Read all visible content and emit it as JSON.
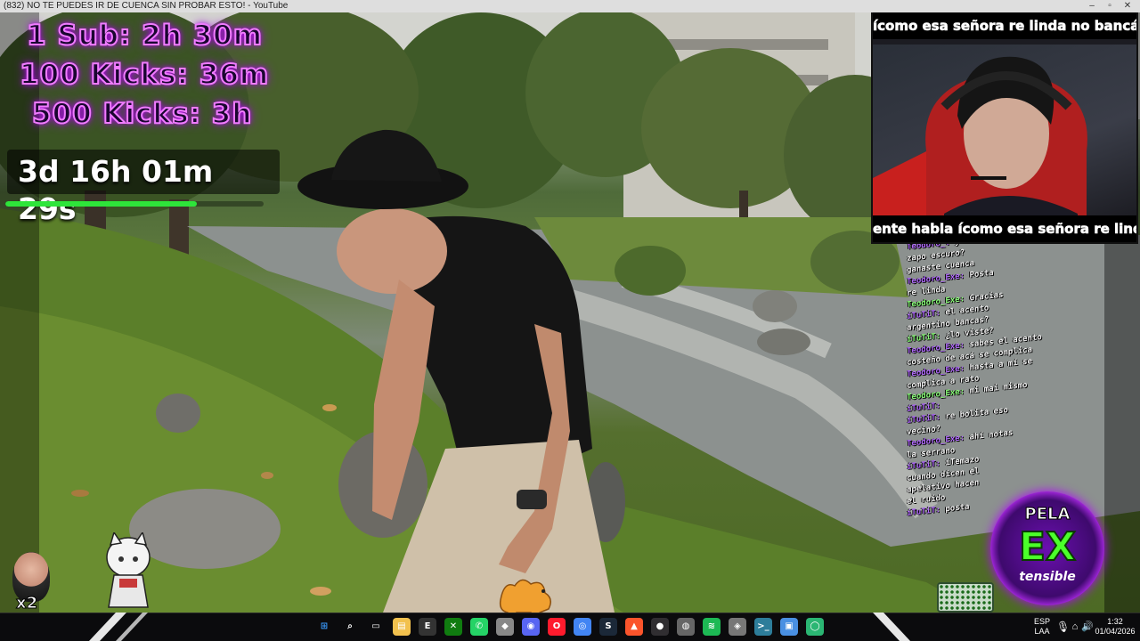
{
  "window": {
    "title": "(832) NO TE PUEDES IR DE CUENCA SIN PROBAR ESTO! - YouTube"
  },
  "overlay": {
    "goals": [
      "1 Sub: 2h 30m",
      "100 Kicks: 36m",
      "500 Kicks: 3h"
    ],
    "countdown": "3d 16h 01m 29s",
    "progress_fraction": 0.74,
    "accent_color": "#2ee53a",
    "goal_glow_color": "#c400ff"
  },
  "webcam": {
    "ticker_top": "ícomo esa señora re linda no bancás",
    "ticker_bottom": "ente habla ícomo esa señora re linda"
  },
  "chat": {
    "lines": [
      {
        "user": "Teodoro_",
        "text": "y te le"
      },
      {
        "user": "",
        "text": "zapo escuro?"
      },
      {
        "user": "",
        "text": "ganaste cuenca"
      },
      {
        "user": "Teodoro_Exe",
        "text": "Posta"
      },
      {
        "user": "",
        "text": "re linda"
      },
      {
        "user": "Teodoro_Exe",
        "text": "Gracias"
      },
      {
        "user": "íTuTiT",
        "text": "el acento"
      },
      {
        "user": "",
        "text": "argentino bancas?"
      },
      {
        "user": "íTuTiT",
        "text": "¿lo viste?"
      },
      {
        "user": "",
        "text": ""
      },
      {
        "user": "Teodoro_Exe",
        "text": "sabes el acento"
      },
      {
        "user": "",
        "text": "costeño de acá se complica"
      },
      {
        "user": "Teodoro_Exe",
        "text": "hasta a mí se"
      },
      {
        "user": "",
        "text": "complica a rato"
      },
      {
        "user": "Teodoro_Exe",
        "text": "mi mai mismo"
      },
      {
        "user": "íTuTiT",
        "text": ""
      },
      {
        "user": "íTuTiT",
        "text": "re bolita eso"
      },
      {
        "user": "",
        "text": "vecino?"
      },
      {
        "user": "",
        "text": ""
      },
      {
        "user": "Teodoro_Exe",
        "text": "ahí notas"
      },
      {
        "user": "",
        "text": "la serrano"
      },
      {
        "user": "íTuTiT",
        "text": "íTemazo"
      },
      {
        "user": "",
        "text": "cuando dicen el"
      },
      {
        "user": "",
        "text": "apelativo hacen"
      },
      {
        "user": "",
        "text": "el ruido"
      },
      {
        "user": "íTuTiT",
        "text": "posta"
      }
    ]
  },
  "logo": {
    "line1": "PELA",
    "line2": "EX",
    "line3": "tensible"
  },
  "multiplier": "x2",
  "taskbar": {
    "language": "ESP",
    "layout": "LAA",
    "time": "1:32",
    "date": "01/04/2026",
    "icons": [
      "start-icon",
      "search-icon",
      "task-view-icon",
      "file-explorer-icon",
      "epic-games-icon",
      "xbox-icon",
      "whatsapp-icon",
      "app-icon",
      "discord-icon",
      "opera-icon",
      "chrome-icon",
      "steam-icon",
      "brave-icon",
      "obs-icon",
      "browser-icon",
      "spotify-icon",
      "app-icon",
      "terminal-icon",
      "app-icon",
      "app-icon"
    ]
  }
}
